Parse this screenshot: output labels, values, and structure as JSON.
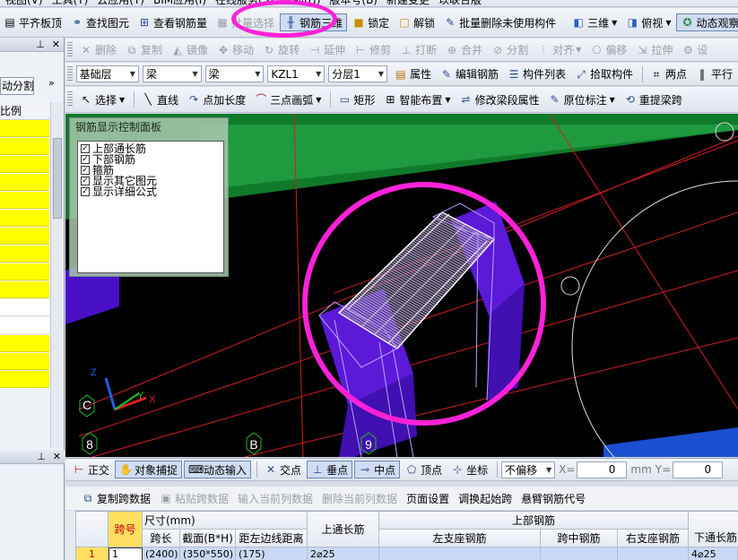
{
  "menubar": {
    "items": [
      "视图(V)",
      "工具(T)",
      "云应用(Y)",
      "BIM应用(I)",
      "在线服务(S)",
      "帮助(H)",
      "版本号(B)",
      "新建变更",
      "以联合版"
    ]
  },
  "toolbar1": [
    {
      "label": "平齐板顶",
      "icon": "align-icon"
    },
    {
      "label": "查找图元",
      "icon": "binoculars-icon"
    },
    {
      "label": "查看钢筋量",
      "icon": "view-rebar-icon"
    },
    {
      "label": "批量选择",
      "icon": "batch-select-icon"
    },
    {
      "label": "钢筋三维",
      "icon": "rebar-3d-icon"
    },
    {
      "label": "锁定",
      "icon": "lock-icon"
    },
    {
      "label": "解锁",
      "icon": "unlock-icon"
    },
    {
      "label": "批量删除未使用构件",
      "icon": "batch-delete-icon"
    },
    {
      "label": "三维",
      "icon": "cube-icon"
    },
    {
      "label": "俯视",
      "icon": "top-view-icon"
    },
    {
      "label": "动态观察",
      "icon": "orbit-icon"
    }
  ],
  "toolbar2": [
    {
      "label": "删除",
      "icon": "delete-icon"
    },
    {
      "label": "复制",
      "icon": "copy-icon"
    },
    {
      "label": "镜像",
      "icon": "mirror-icon"
    },
    {
      "label": "移动",
      "icon": "move-icon"
    },
    {
      "label": "旋转",
      "icon": "rotate-icon"
    },
    {
      "label": "延伸",
      "icon": "extend-icon"
    },
    {
      "label": "修剪",
      "icon": "trim-icon"
    },
    {
      "label": "打断",
      "icon": "break-icon"
    },
    {
      "label": "合并",
      "icon": "merge-icon"
    },
    {
      "label": "分割",
      "icon": "split-icon"
    },
    {
      "label": "对齐",
      "icon": "align-dropdown-icon"
    },
    {
      "label": "偏移",
      "icon": "offset-icon"
    },
    {
      "label": "拉伸",
      "icon": "stretch-icon"
    },
    {
      "label": "设",
      "icon": "settings-icon"
    }
  ],
  "toolbar3": {
    "combos": [
      "基础层",
      "梁",
      "梁",
      "KZL1",
      "分层1"
    ],
    "buttons": [
      {
        "label": "属性",
        "icon": "property-icon"
      },
      {
        "label": "编辑钢筋",
        "icon": "edit-rebar-icon"
      },
      {
        "label": "构件列表",
        "icon": "list-icon"
      },
      {
        "label": "拾取构件",
        "icon": "pick-icon"
      },
      {
        "label": "两点",
        "icon": "two-point-icon"
      },
      {
        "label": "平行",
        "icon": "parallel-icon"
      }
    ]
  },
  "toolbar4": [
    {
      "label": "选择",
      "icon": "select-cursor-icon"
    },
    {
      "label": "直线",
      "icon": "line-icon"
    },
    {
      "label": "点加长度",
      "icon": "point-length-icon"
    },
    {
      "label": "三点画弧",
      "icon": "arc-icon"
    },
    {
      "label": "矩形",
      "icon": "rectangle-icon"
    },
    {
      "label": "智能布置",
      "icon": "smart-layout-icon"
    },
    {
      "label": "修改梁段属性",
      "icon": "modify-beam-icon"
    },
    {
      "label": "原位标注",
      "icon": "in-situ-icon"
    },
    {
      "label": "重提梁跨",
      "icon": "respan-icon"
    }
  ],
  "left_panel": {
    "tab": "动分割",
    "header": "比例"
  },
  "control_panel": {
    "title": "钢筋显示控制面板",
    "items": [
      "上部通长筋",
      "下部钢筋",
      "箍筋",
      "显示其它图元",
      "显示详细公式"
    ]
  },
  "axis_labels": {
    "c": "C",
    "n8": "8",
    "b": "B",
    "n9": "9",
    "x": "X",
    "y": "Y",
    "z": "Z"
  },
  "snap_bar": {
    "buttons": [
      {
        "label": "正交",
        "icon": "ortho-icon"
      },
      {
        "label": "对象捕捉",
        "icon": "snap-icon"
      },
      {
        "label": "动态输入",
        "icon": "dynamic-input-icon"
      },
      {
        "label": "交点",
        "icon": "intersection-icon"
      },
      {
        "label": "垂点",
        "icon": "perpendicular-icon"
      },
      {
        "label": "中点",
        "icon": "midpoint-icon"
      },
      {
        "label": "顶点",
        "icon": "vertex-icon"
      },
      {
        "label": "坐标",
        "icon": "coordinate-icon"
      }
    ],
    "offset_combo": "不偏移",
    "x_label": "X=",
    "x_value": "0",
    "unit": "mm",
    "y_label": "Y=",
    "y_value": "0"
  },
  "edit_bar": [
    "复制跨数据",
    "粘贴跨数据",
    "输入当前列数据",
    "删除当前列数据",
    "页面设置",
    "调换起始跨",
    "悬臂钢筋代号"
  ],
  "grid": {
    "headers": {
      "span": "跨号",
      "size": "尺寸(mm)",
      "span_len": "跨长",
      "section": "截面(B*H)",
      "dist_left": "距左边线距离",
      "top_long": "上通长筋",
      "top_rebar": "上部钢筋",
      "left_support": "左支座钢筋",
      "mid_span": "跨中钢筋",
      "right_support": "右支座钢筋",
      "bottom_long": "下通长筋"
    },
    "row": {
      "num": "1",
      "span": "1",
      "span_len": "(2400)",
      "section": "(350*550)",
      "dist_left": "(175)",
      "top_long": "2⌀25",
      "left_support": "",
      "mid_span": "",
      "right_support": "",
      "bottom_long": "4⌀25"
    }
  }
}
